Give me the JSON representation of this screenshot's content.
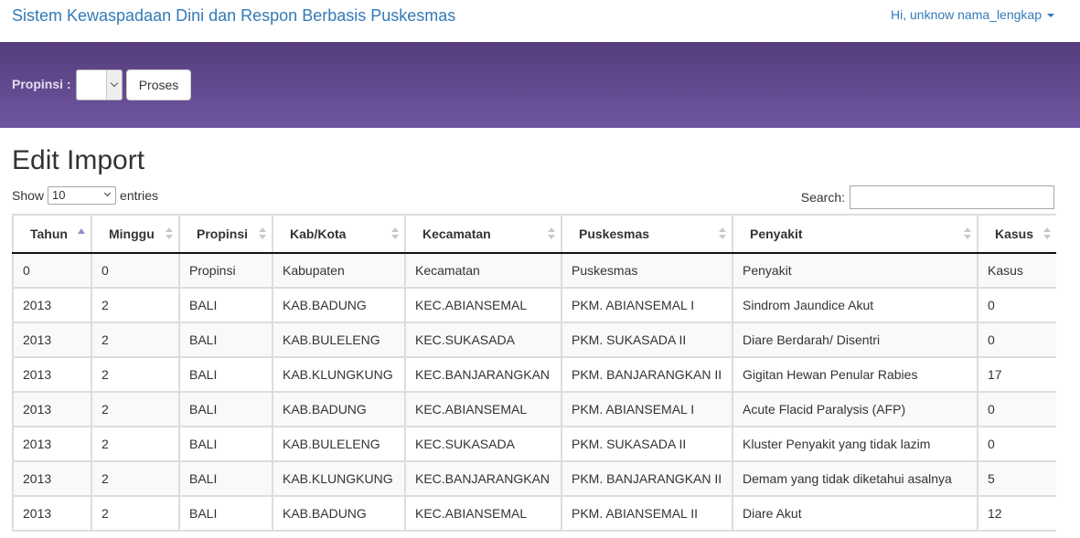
{
  "navbar": {
    "brand": "Sistem Kewaspadaan Dini dan Respon Berbasis Puskesmas",
    "user_menu": "Hi, unknow nama_lengkap"
  },
  "filter": {
    "propinsi_label": "Propinsi :",
    "propinsi_value": "",
    "proses_label": "Proses"
  },
  "page": {
    "title": "Edit Import"
  },
  "table_controls": {
    "show_label": "Show",
    "entries_value": "10",
    "entries_label": "entries",
    "search_label": "Search:",
    "search_value": ""
  },
  "table": {
    "columns": [
      "Tahun",
      "Minggu",
      "Propinsi",
      "Kab/Kota",
      "Kecamatan",
      "Puskesmas",
      "Penyakit",
      "Kasus"
    ],
    "sorted_column": "Tahun",
    "sort_direction": "asc",
    "rows": [
      [
        "0",
        "0",
        "Propinsi",
        "Kabupaten",
        "Kecamatan",
        "Puskesmas",
        "Penyakit",
        "Kasus"
      ],
      [
        "2013",
        "2",
        "BALI",
        "KAB.BADUNG",
        "KEC.ABIANSEMAL",
        "PKM. ABIANSEMAL I",
        "Sindrom Jaundice Akut",
        "0"
      ],
      [
        "2013",
        "2",
        "BALI",
        "KAB.BULELENG",
        "KEC.SUKASADA",
        "PKM. SUKASADA II",
        "Diare Berdarah/ Disentri",
        "0"
      ],
      [
        "2013",
        "2",
        "BALI",
        "KAB.KLUNGKUNG",
        "KEC.BANJARANGKAN",
        "PKM. BANJARANGKAN II",
        "Gigitan Hewan Penular Rabies",
        "17"
      ],
      [
        "2013",
        "2",
        "BALI",
        "KAB.BADUNG",
        "KEC.ABIANSEMAL",
        "PKM. ABIANSEMAL I",
        "Acute Flacid Paralysis (AFP)",
        "0"
      ],
      [
        "2013",
        "2",
        "BALI",
        "KAB.BULELENG",
        "KEC.SUKASADA",
        "PKM. SUKASADA II",
        "Kluster Penyakit yang tidak lazim",
        "0"
      ],
      [
        "2013",
        "2",
        "BALI",
        "KAB.KLUNGKUNG",
        "KEC.BANJARANGKAN",
        "PKM. BANJARANGKAN II",
        "Demam yang tidak diketahui asalnya",
        "5"
      ],
      [
        "2013",
        "2",
        "BALI",
        "KAB.BADUNG",
        "KEC.ABIANSEMAL",
        "PKM. ABIANSEMAL II",
        "Diare Akut",
        "12"
      ]
    ]
  },
  "colors": {
    "brand_link": "#337ab7",
    "band_top": "#563d7c",
    "band_bottom": "#6f55a0"
  }
}
